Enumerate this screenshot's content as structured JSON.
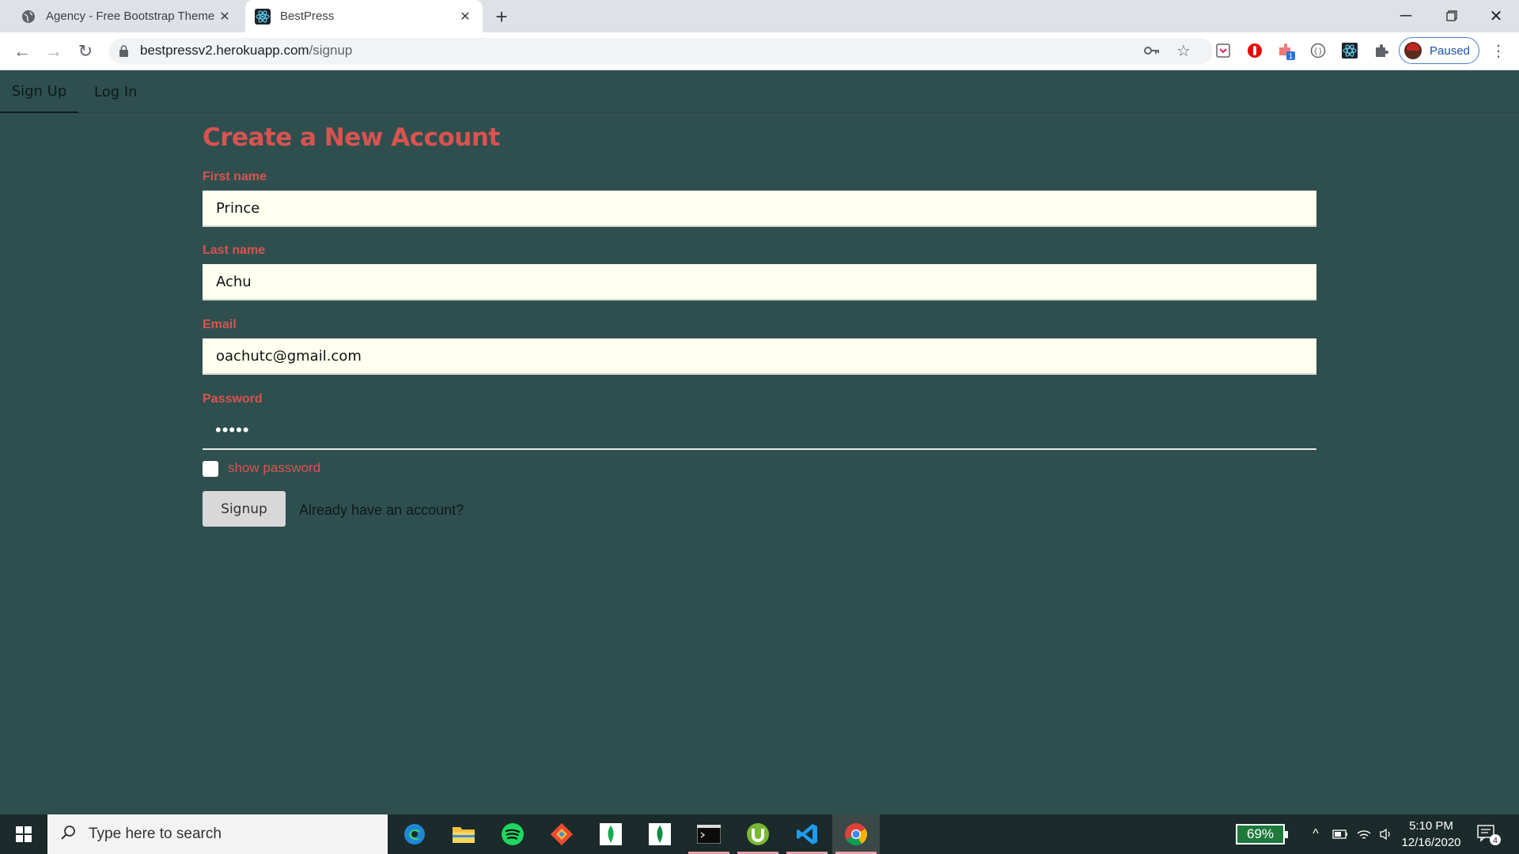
{
  "browser": {
    "tabs": [
      {
        "title": "Agency - Free Bootstrap Theme b",
        "icon": "globe-icon",
        "active": false
      },
      {
        "title": "BestPress",
        "icon": "react-icon",
        "active": true
      }
    ],
    "url_host": "bestpressv2.herokuapp.com",
    "url_path": "/signup",
    "profile_label": "Paused",
    "extension_badge": "1"
  },
  "nav": {
    "signup": "Sign Up",
    "login": "Log In"
  },
  "form": {
    "title": "Create a New Account",
    "first_name_label": "First name",
    "first_name_value": "Prince",
    "last_name_label": "Last name",
    "last_name_value": "Achu",
    "email_label": "Email",
    "email_value": "oachutc@gmail.com",
    "password_label": "Password",
    "password_value": "•••••",
    "show_password_label": "show password",
    "show_password_checked": false,
    "signup_button": "Signup",
    "already_text": "Already have an account?"
  },
  "taskbar": {
    "search_placeholder": "Type here to search",
    "apps": [
      "edge-icon",
      "file-explorer-icon",
      "spotify-icon",
      "git-icon",
      "mongodb-icon",
      "mongodb-compass-icon",
      "terminal-icon",
      "utorrent-icon",
      "vscode-icon",
      "chrome-icon"
    ],
    "battery": "69%",
    "time": "5:10 PM",
    "date": "12/16/2020",
    "notifications": "4"
  },
  "colors": {
    "page_bg": "#2f4f4f",
    "accent": "#d9534f",
    "input_bg": "#fffff0"
  }
}
